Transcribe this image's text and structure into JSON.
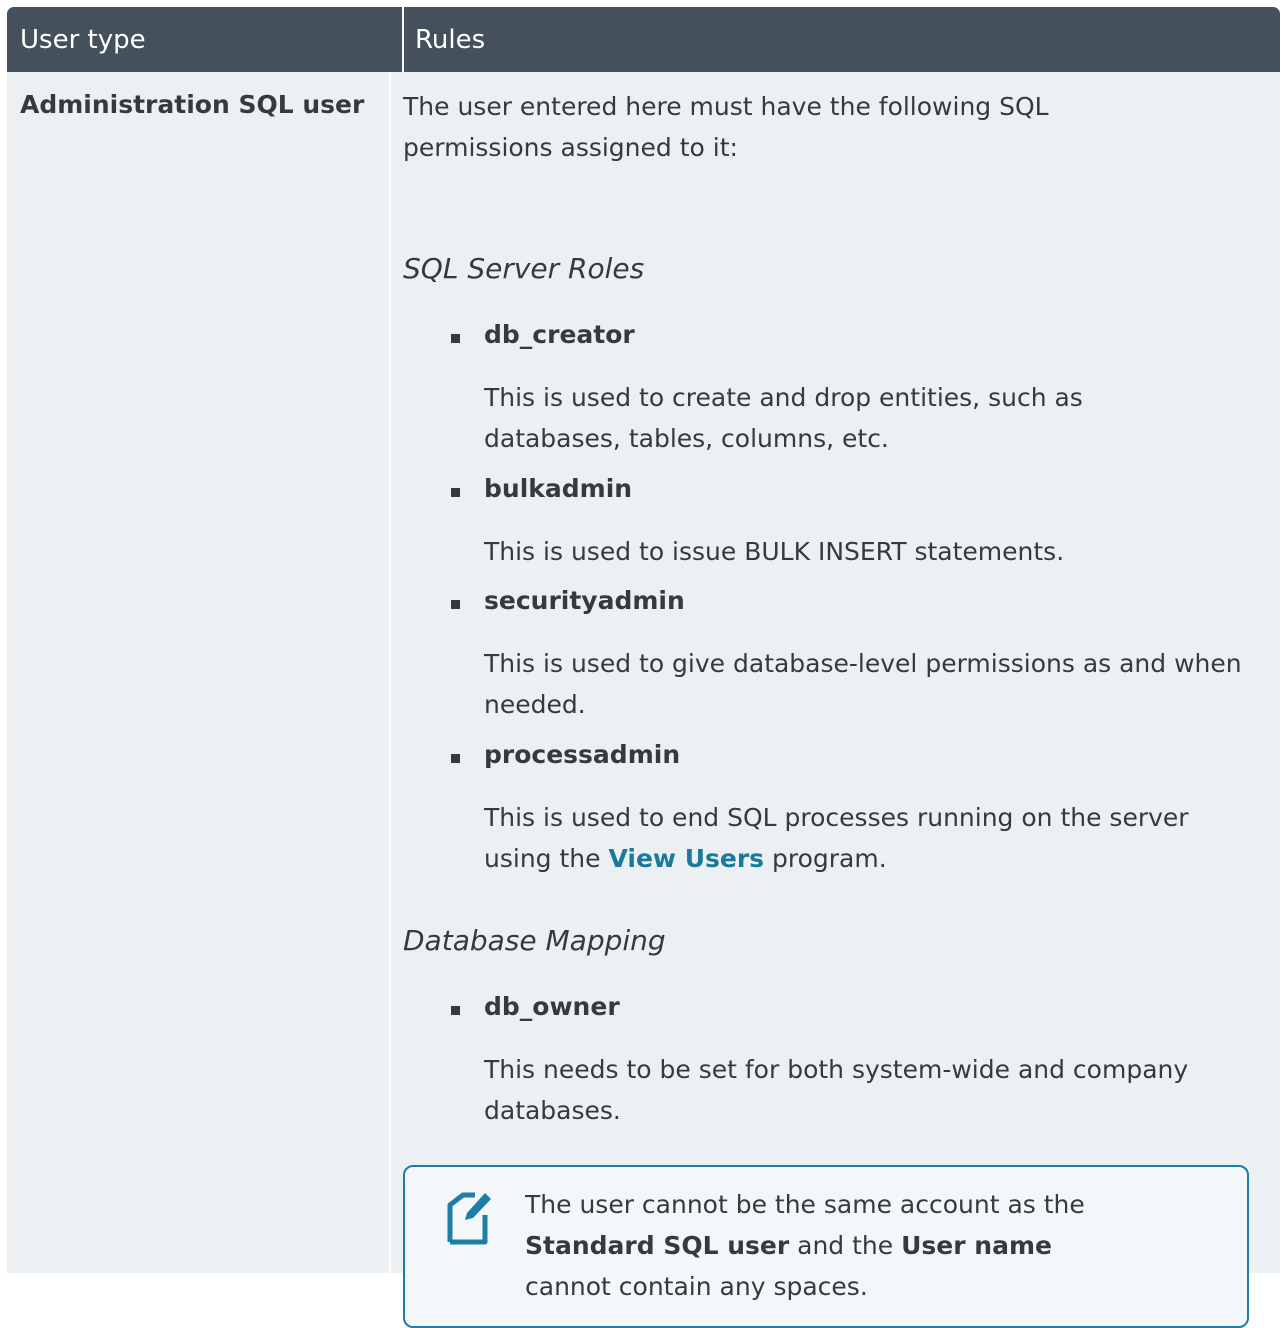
{
  "header": {
    "col1": "User type",
    "col2": "Rules"
  },
  "row": {
    "user_type": "Administration SQL user",
    "intro": "The user entered here must have the following SQL permissions assigned to it:",
    "sql_server_roles_heading": "SQL Server Roles",
    "roles": [
      {
        "name": "db_creator",
        "desc": "This is used to create and drop entities, such as databases, tables, columns, etc."
      },
      {
        "name": "bulkadmin",
        "desc": "This is used to issue BULK INSERT statements."
      },
      {
        "name": "securityadmin",
        "desc": "This is used to give database-level permissions as and when needed."
      },
      {
        "name": "processadmin",
        "desc_before": "This is used to end SQL processes running on the server using the",
        "desc_link": "View Users",
        "desc_after": "program."
      }
    ],
    "db_mapping_heading": "Database Mapping",
    "mapping": [
      {
        "name": "db_owner",
        "desc": "This needs to be set for both system-wide and company databases."
      }
    ],
    "note": {
      "icon": "note-edit-icon",
      "t1": "The user cannot be the same account as the",
      "b1": "Standard SQL user",
      "t2": "and the",
      "b2": "User name",
      "t3": "cannot contain any spaces."
    }
  },
  "colors": {
    "header_bg": "#44505b",
    "body_bg": "#ecf0f2",
    "link": "#1a7a9c",
    "note_border": "#1f7ea7"
  }
}
